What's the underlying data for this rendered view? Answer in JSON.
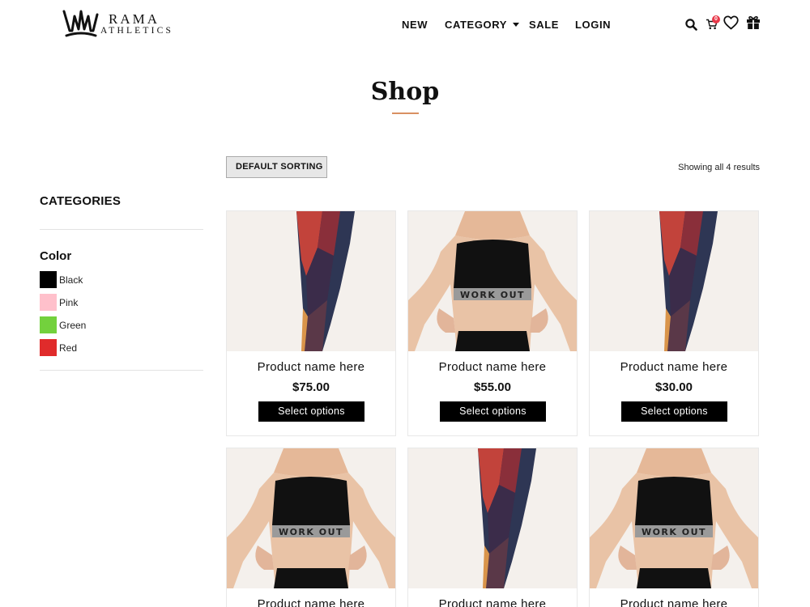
{
  "brand": {
    "name_top": "RAMA",
    "name_bottom": "ATHLETICS"
  },
  "nav": {
    "items": [
      {
        "label": "NEW"
      },
      {
        "label": "CATEGORY"
      },
      {
        "label": "SALE"
      },
      {
        "label": "LOGIN"
      }
    ]
  },
  "header_icons": {
    "search": "search-icon",
    "cart": "cart-icon",
    "cart_count": "0",
    "wishlist": "heart-icon",
    "gift": "gift-icon"
  },
  "page": {
    "title": "Shop"
  },
  "toolbar": {
    "sort_label": "DEFAULT SORTING",
    "result_count": "Showing all 4 results"
  },
  "sidebar": {
    "categories_heading": "CATEGORIES",
    "color_heading": "Color",
    "colors": [
      {
        "label": "Black",
        "hex": "#000000"
      },
      {
        "label": "Pink",
        "hex": "#ffc0cb"
      },
      {
        "label": "Green",
        "hex": "#73d13d"
      },
      {
        "label": "Red",
        "hex": "#e02b2b"
      }
    ]
  },
  "products": [
    {
      "name": "Product name here",
      "price": "$75.00",
      "button": "Select options",
      "image": "leggings"
    },
    {
      "name": "Product name here",
      "price": "$55.00",
      "button": "Select options",
      "image": "sports-bra",
      "print": "WORK OUT"
    },
    {
      "name": "Product name here",
      "price": "$30.00",
      "button": "Select options",
      "image": "leggings"
    },
    {
      "name": "Product name here",
      "image": "sports-bra",
      "print": "WORK OUT"
    },
    {
      "name": "Product name here",
      "image": "leggings"
    },
    {
      "name": "Product name here",
      "image": "sports-bra",
      "print": "WORK OUT"
    }
  ],
  "colors": {
    "accent": "#d99062",
    "badge": "#e8394a",
    "button_bg": "#000000",
    "image_bg": "#f4f0ec"
  }
}
